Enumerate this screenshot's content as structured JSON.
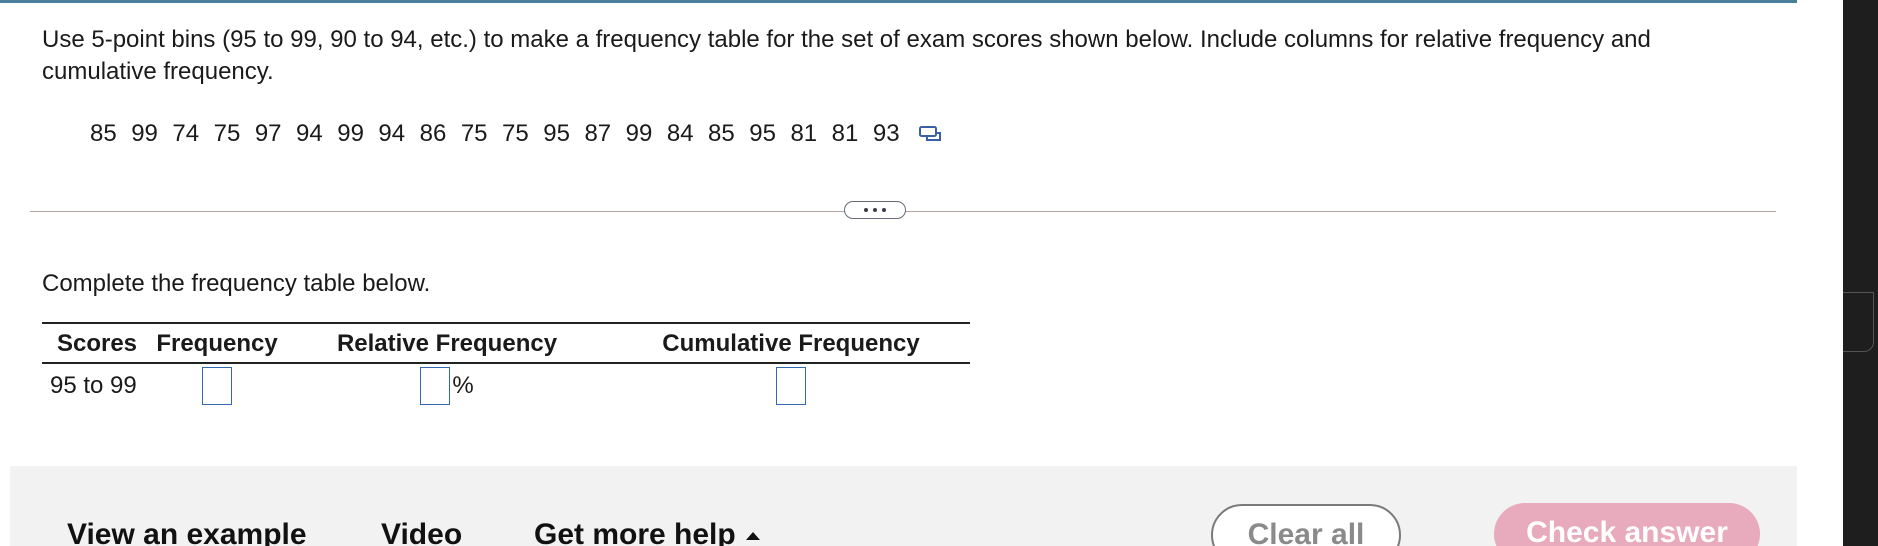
{
  "question": {
    "text": "Use 5-point bins (95 to 99, 90 to 94, etc.) to make a frequency table for the set of exam scores shown below. Include columns for relative frequency and cumulative frequency."
  },
  "scores": [
    "85",
    "99",
    "74",
    "75",
    "97",
    "94",
    "99",
    "94",
    "86",
    "75",
    "75",
    "95",
    "87",
    "99",
    "84",
    "85",
    "95",
    "81",
    "81",
    "93"
  ],
  "icons": {
    "copy": "copy-data-icon",
    "expand": "more-dots-icon"
  },
  "instruction": "Complete the frequency table below.",
  "table": {
    "headers": [
      "Scores",
      "Frequency",
      "Relative Frequency",
      "Cumulative Frequency"
    ],
    "rows": [
      {
        "scores": "95 to 99",
        "frequency": "",
        "relative_frequency": "",
        "relative_unit": "%",
        "cumulative_frequency": ""
      }
    ]
  },
  "footer": {
    "view_example": "View an example",
    "video": "Video",
    "get_more_help": "Get more help",
    "clear_all": "Clear all",
    "check_answer": "Check answer"
  },
  "colors": {
    "accent_top": "#4a7f9c",
    "input_border": "#3366b3",
    "check_answer_bg": "#e8aabd",
    "footer_bg": "#f2f2f2"
  }
}
